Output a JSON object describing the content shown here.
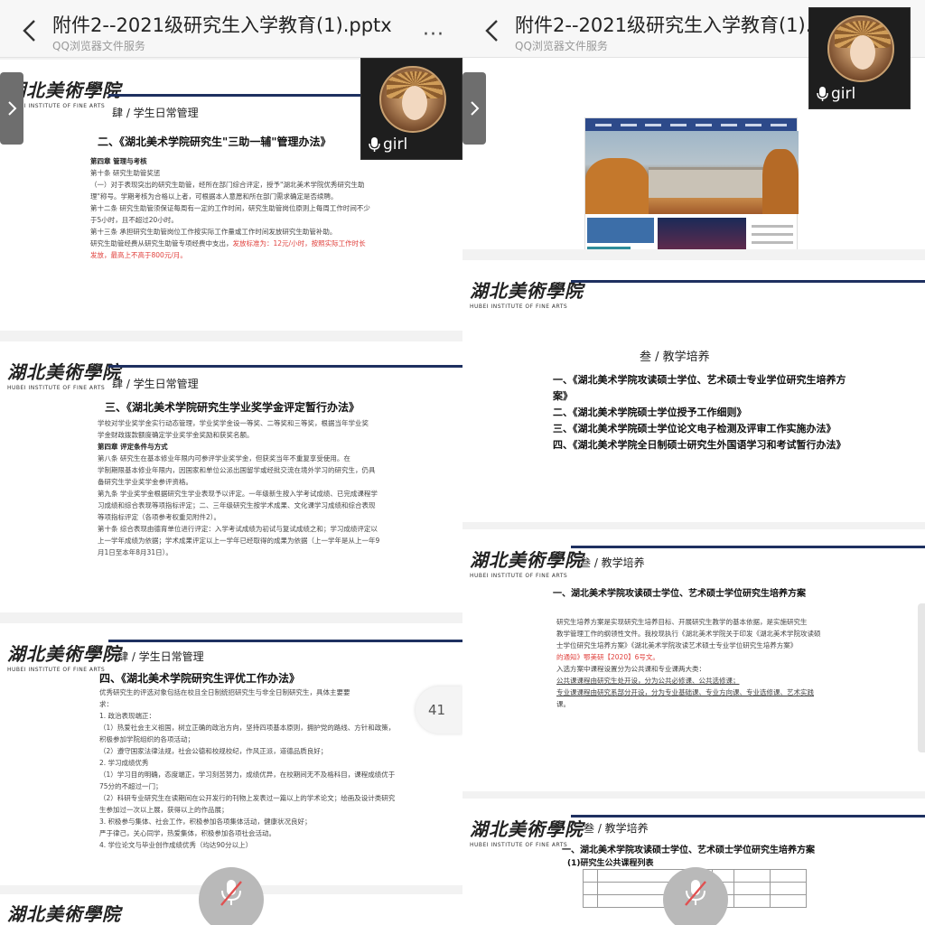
{
  "left": {
    "header": {
      "title": "附件2--2021级研究生入学教育(1).pptx",
      "subtitle": "QQ浏览器文件服务",
      "more": "···"
    },
    "video": {
      "name": "girl"
    },
    "page_number": "41",
    "logo": {
      "cn": "湖北美術學院",
      "en": "HUBEI INSTITUTE OF FINE ARTS"
    },
    "slide1": {
      "section": "肆 / 学生日常管理",
      "heading": "二、《湖北美术学院研究生\"三助一辅\"管理办法》",
      "lines": [
        "第四章 管理与考核",
        "第十条 研究生助管奖惩",
        "（一）对于表现突出的研究生助管，经所在部门综合评定，授予\"湖北美术学院优秀研究生助",
        "      理\"称号。学期考核为合格以上者，可根据本人意愿和所在部门需求确定是否续聘。",
        "第十二条 研究生助管须保证每周有一定的工作时间，研究生助管岗位原则上每周工作时间不少",
        "      于5小时，且不超过20小时。",
        "第十三条 承担研究生助管岗位工作按实际工作量或工作时间发放研究生助管补助。"
      ],
      "line_last": "研究生助管经费从研究生助管专项经费中支出，",
      "line_last_red": "发放标准为：12元/小时，按照实际工作时长",
      "line_red2": "发放，最高上不高于800元/月。"
    },
    "slide2": {
      "section": "肆 / 学生日常管理",
      "heading": "三、《湖北美术学院研究生学业奖学金评定暂行办法》",
      "lines": [
        "学校对学业奖学金实行动态管理，学业奖学金设一等奖、二等奖和三等奖，根据当年学业奖",
        "学金财政拨款额度确定学业奖学金奖励和获奖名额。",
        "第四章 评定条件与方式",
        "第八条 研究生在基本修业年限内可参评学业奖学金，但获奖当年不重复享受使用。在",
        "学制期限基本修业年限内，因国家和单位公派出国留学或经批交流在境外学习的研究生，仍具",
        "备研究生学业奖学金参评资格。",
        "第九条 学业奖学金根据研究生学业表现予以评定。一年级新生按入学考试成绩、已完成课程学",
        "习成绩和综合表现等项指标评定；二、三年级研究生按学术成果、文化课学习成绩和综合表现",
        "等项指标评定（各项参考权重见附件2）。",
        "第十条 综合表现由德育单位进行评定：入学考试成绩为初试与复试成绩之和；学习成绩评定以",
        "上一学年成绩为依据；学术成果评定以上一学年已经取得的成果为依据（上一学年是从上一年9",
        "月1日至本年8月31日）。"
      ]
    },
    "slide3": {
      "section": "肆 / 学生日常管理",
      "heading": "四、《湖北美术学院研究生评优工作办法》",
      "lines": [
        "优秀研究生的评选对象包括在校且全日制统招研究生与非全日制研究生，具体主要要",
        "求：",
        "1. 政治表现端正：",
        "（1）热爱社会主义祖国，树立正确的政治方向，坚持四项基本原则，拥护党的路线、方针和政策，",
        "积极参加学院组织的各项活动；",
        "（2）遵守国家法律法规，社会公德和校规校纪，作风正派，道德品质良好；",
        "2. 学习成绩优秀",
        "（1）学习目的明确，态度端正，学习刻苦努力，成绩优异，在校期间无不及格科目，课程成绩优于",
        "75分的不超过一门；",
        "（2）科研专业研究生在读期间在公开发行的刊物上发表过一篇以上的学术论文；绘画及设计类研究",
        "生参加过一次以上展，获得以上的作品展；",
        "3. 积极参与集体、社会工作，积极参加各项集体活动，健康状况良好；",
        "严于律己，关心同学，热爱集体，积极参加各项社会活动。",
        "4. 学位论文与毕业创作成绩优秀（均达90分以上）"
      ]
    },
    "slide4": {
      "logo_partial": "湖北美術學院"
    }
  },
  "right": {
    "header": {
      "title": "附件2--2021级研究生入学教育(1).pptx",
      "subtitle": "QQ浏览器文件服务"
    },
    "video": {
      "name": "girl"
    },
    "slide2": {
      "section": "叁 / 教学培养",
      "items": [
        "一、《湖北美术学院攻读硕士学位、艺术硕士专业学位研究生培养方",
        "案》",
        "二、《湖北美术学院硕士学位授予工作细则》",
        "三、《湖北美术学院硕士学位论文电子检测及评审工作实施办法》",
        "四、《湖北美术学院全日制硕士研究生外国语学习和考试暂行办法》"
      ]
    },
    "slide3": {
      "section": "叁 / 教学培养",
      "heading": "一、湖北美术学院攻读硕士学位、艺术硕士学位研究生培养方案",
      "lines": [
        "研究生培养方案是实现研究生培养目标、开展研究生教学的基本依据，是实施研究生",
        "教学管理工作的纲领性文件。我校现执行《湖北美术学院关于印发《湖北美术学院攻读硕",
        "士学位研究生培养方案》《湖北美术学院攻读艺术硕士专业学位研究生培养方案》"
      ],
      "line_red": "的通知》鄂美研【2020】6号文。",
      "lines2": [
        "入选方案中课程设置分为公共课和专业课两大类：",
        "公共课课程由研究生处开设，分为公共必修课、公共选修课；",
        "专业课课程由研究系部分开设，分为专业基础课、专业方向课、专业选修课、艺术实践",
        "课。"
      ]
    },
    "slide4": {
      "section": "叁 / 教学培养",
      "heading": "一、湖北美术学院攻读硕士学位、艺术硕士学位研究生培养方案",
      "subheading": "(1)研究生公共课程列表"
    }
  },
  "colors": {
    "navy": "#1e3060",
    "red_text": "#e0403c"
  }
}
